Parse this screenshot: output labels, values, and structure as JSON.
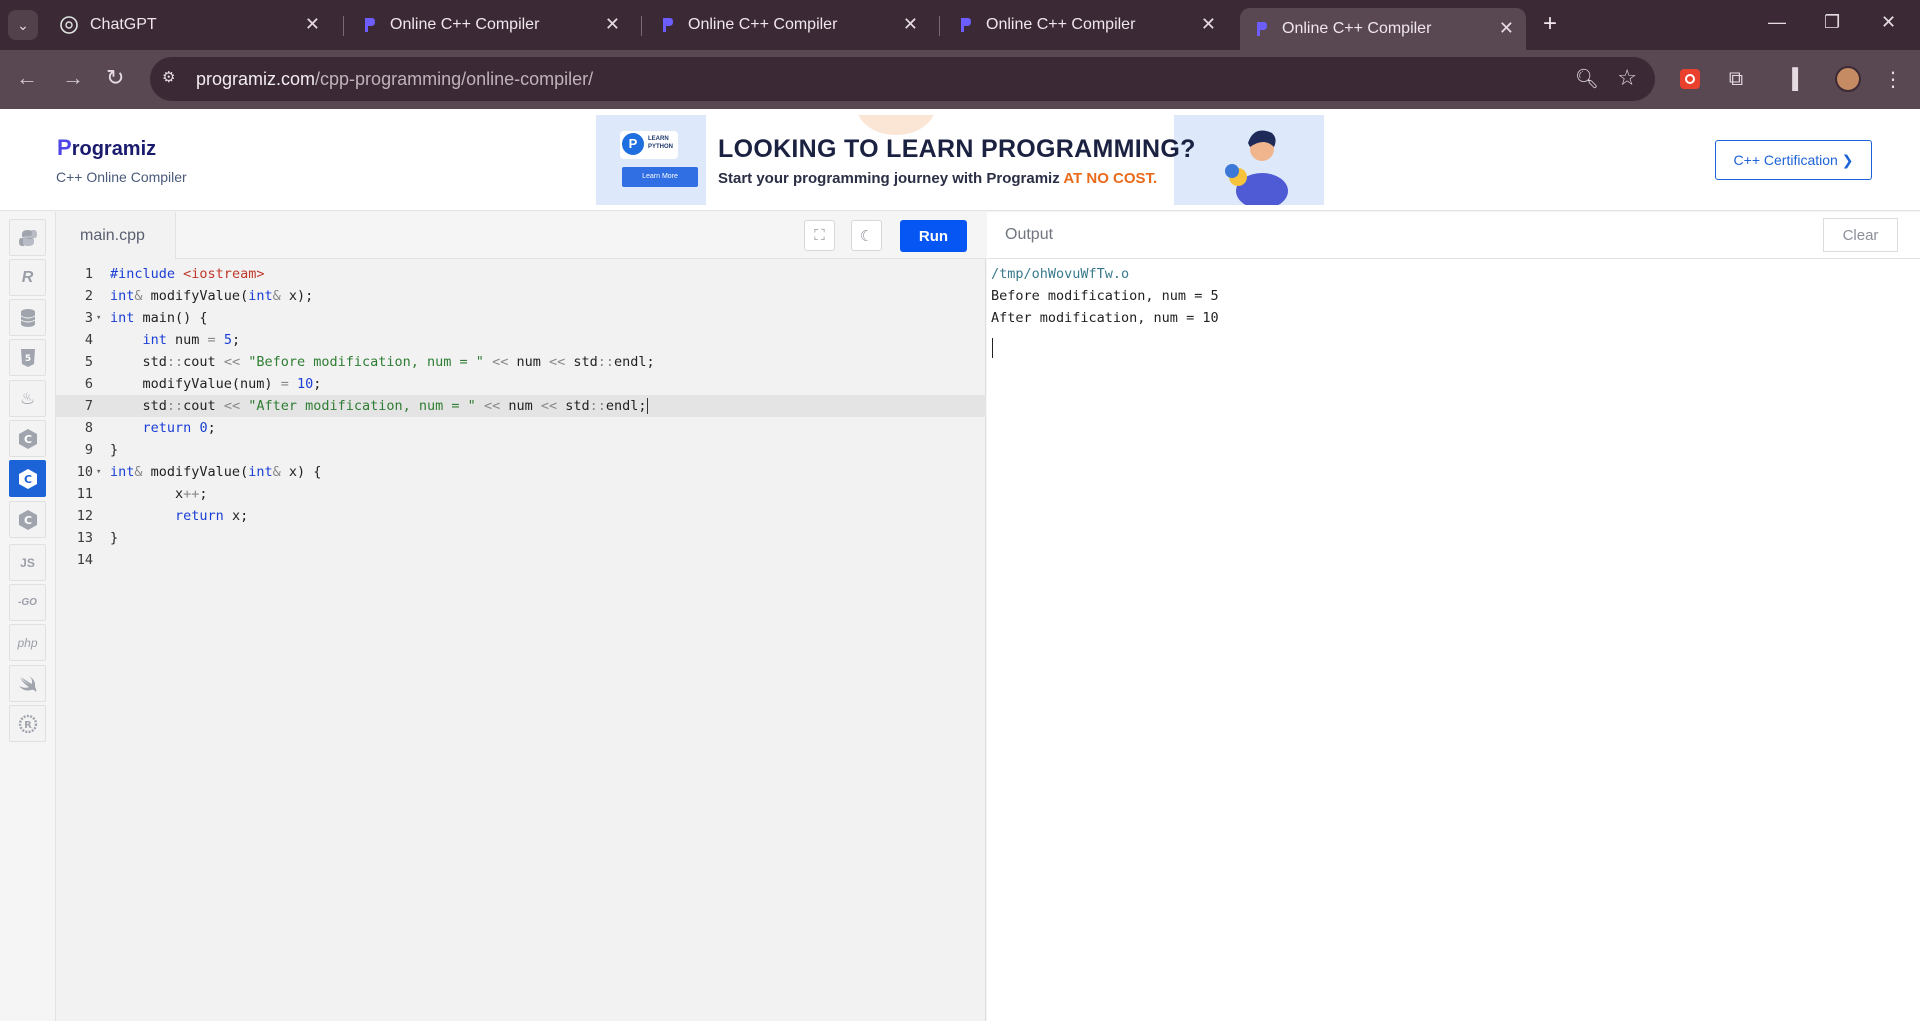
{
  "browser": {
    "tabs": [
      {
        "title": "ChatGPT",
        "icon": "chatgpt-favicon",
        "active": false
      },
      {
        "title": "Online C++ Compiler",
        "icon": "programiz-favicon",
        "active": false
      },
      {
        "title": "Online C++ Compiler",
        "icon": "programiz-favicon",
        "active": false
      },
      {
        "title": "Online C++ Compiler",
        "icon": "programiz-favicon",
        "active": false
      },
      {
        "title": "Online C++ Compiler",
        "icon": "programiz-favicon",
        "active": true
      }
    ],
    "url_domain": "programiz.com",
    "url_path": "/cpp-programming/online-compiler/"
  },
  "header": {
    "logo": "rogramiz",
    "logo_initial": "P",
    "subtitle": "C++ Online Compiler",
    "cert_button": "C++ Certification ❯"
  },
  "banner": {
    "badge_text": "LEARN PYTHON",
    "button": "Learn More",
    "headline": "LOOKING TO LEARN PROGRAMMING?",
    "tagline": "Start your programming journey with Programiz ",
    "tagline_highlight": "AT NO COST."
  },
  "languages": [
    "python",
    "r",
    "sql",
    "html",
    "java",
    "c",
    "cpp",
    "csharp",
    "js",
    "go",
    "php",
    "swift",
    "rust"
  ],
  "active_language": "cpp",
  "language_labels": {
    "js": "JS",
    "go": "-GO",
    "php": "php"
  },
  "editor": {
    "file_name": "main.cpp",
    "run_label": "Run",
    "active_line": 7,
    "line_numbers": [
      "1",
      "2",
      "3",
      "4",
      "5",
      "6",
      "7",
      "8",
      "9",
      "10",
      "11",
      "12",
      "13",
      "14"
    ],
    "lines": [
      "#include <iostream>",
      "int& modifyValue(int& x);",
      "int main() {",
      "    int num = 5;",
      "    std::cout << \"Before modification, num = \" << num << std::endl;",
      "    modifyValue(num) = 10;",
      "    std::cout << \"After modification, num = \" << num << std::endl;",
      "    return 0;",
      "}",
      "int& modifyValue(int& x) {",
      "        x++;",
      "        return x;",
      "}",
      ""
    ]
  },
  "output": {
    "title": "Output",
    "clear_label": "Clear",
    "lines": [
      "/tmp/ohWovuWfTw.o",
      "Before modification, num = 5",
      "After modification, num = 10"
    ]
  },
  "colors": {
    "accent": "#0556f3",
    "tabbar": "#3b2a35",
    "toolbar": "#594852"
  }
}
